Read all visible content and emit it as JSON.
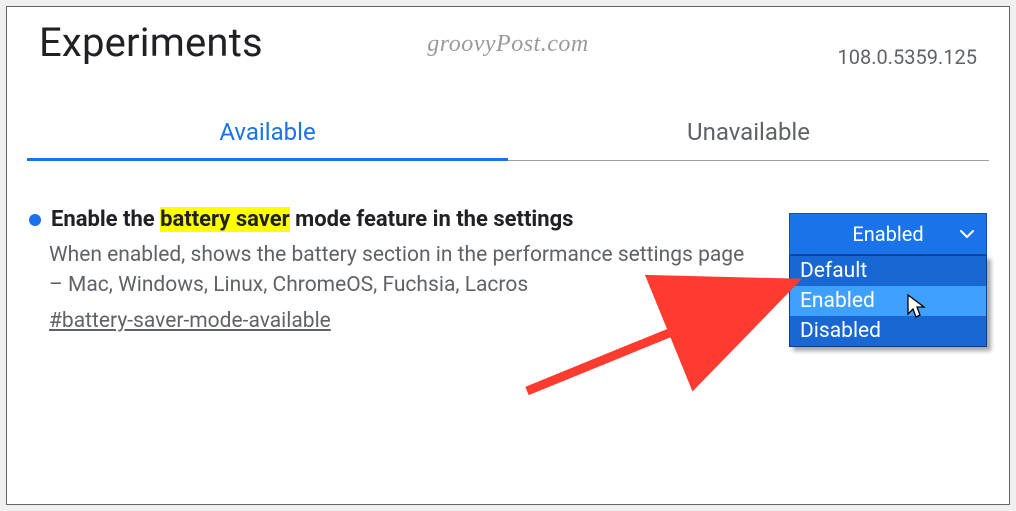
{
  "watermark": "groovyPost.com",
  "page_title": "Experiments",
  "version": "108.0.5359.125",
  "tabs": {
    "available": "Available",
    "unavailable": "Unavailable"
  },
  "flag": {
    "title_pre": "Enable the ",
    "title_highlight": "battery saver",
    "title_post": " mode feature in the settings",
    "description": "When enabled, shows the battery section in the performance settings page – Mac, Windows, Linux, ChromeOS, Fuchsia, Lacros",
    "hash": "#battery-saver-mode-available"
  },
  "select": {
    "current": "Enabled",
    "options": {
      "default": "Default",
      "enabled": "Enabled",
      "disabled": "Disabled"
    }
  }
}
